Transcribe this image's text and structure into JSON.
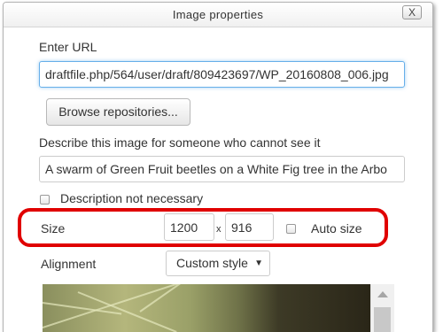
{
  "dialog": {
    "title": "Image properties",
    "close_label": "X"
  },
  "url": {
    "label": "Enter URL",
    "value": "draftfile.php/564/user/draft/809423697/WP_20160808_006.jpg"
  },
  "browse_button_label": "Browse repositories...",
  "description": {
    "label": "Describe this image for someone who cannot see it",
    "value": "A swarm of Green Fruit beetles on a White Fig tree in the Arbo"
  },
  "description_not_necessary": {
    "label": "Description not necessary",
    "checked": false
  },
  "size": {
    "label": "Size",
    "width": "1200",
    "separator": "x",
    "height": "916",
    "auto_size_label": "Auto size",
    "auto_size_checked": false
  },
  "alignment": {
    "label": "Alignment",
    "selected": "Custom style"
  },
  "colors": {
    "highlight": "#e00000",
    "focus": "#66afe9"
  }
}
